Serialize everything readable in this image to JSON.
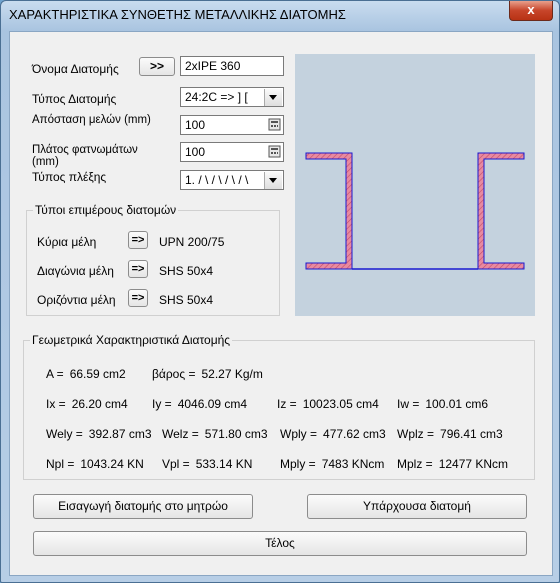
{
  "window": {
    "title": "ΧΑΡΑΚΤΗΡΙΣΤΙΚΑ ΣΥΝΘΕΤΗΣ ΜΕΤΑΛΛΙΚΗΣ ΔΙΑΤΟΜΗΣ",
    "close_glyph": "x"
  },
  "form": {
    "name_label": "Όνομα Διατομής",
    "browse_button": ">>",
    "name_value": "2xIPE 360",
    "type_label": "Τύπος Διατομής",
    "type_value": "24:2C => ] [",
    "distance_label": "Απόσταση μελών (mm)",
    "distance_value": "100",
    "width_label": "Πλάτος φατνωμάτων (mm)",
    "width_value": "100",
    "lacing_label": "Τύπος πλέξης",
    "lacing_value": "1. / \\ / \\ / \\ / \\"
  },
  "members": {
    "title": "Τύποι επιμέρους διατομών",
    "main_label": "Κύρια μέλη",
    "main_value": "UPN 200/75",
    "diagonal_label": "Διαγώνια μέλη",
    "diagonal_value": "SHS 50x4",
    "horizontal_label": "Οριζόντια μέλη",
    "horizontal_value": "SHS 50x4",
    "arrow_label": "=>"
  },
  "geometry": {
    "title": "Γεωμετρικά Χαρακτηριστικά Διατομής",
    "A_label": "A =",
    "A_value": "66.59 cm2",
    "weight_label": "βάρος =",
    "weight_value": "52.27 Kg/m",
    "Ix_label": "Ix =",
    "Ix_value": "26.20 cm4",
    "Iy_label": "Iy =",
    "Iy_value": "4046.09 cm4",
    "Iz_label": "Iz =",
    "Iz_value": "10023.05 cm4",
    "Iw_label": "Iw =",
    "Iw_value": "100.01 cm6",
    "Wely_label": "Wely =",
    "Wely_value": "392.87 cm3",
    "Welz_label": "Welz =",
    "Welz_value": "571.80 cm3",
    "Wply_label": "Wply =",
    "Wply_value": "477.62 cm3",
    "Wplz_label": "Wplz =",
    "Wplz_value": "796.41 cm3",
    "Npl_label": "Npl =",
    "Npl_value": "1043.24 KN",
    "Vpl_label": "Vpl =",
    "Vpl_value": "533.14 KN",
    "Mply_label": "Mply =",
    "Mply_value": "7483 KNcm",
    "Mplz_label": "Mplz =",
    "Mplz_value": "12477 KNcm"
  },
  "buttons": {
    "insert": "Εισαγωγή διατομής στο μητρώο",
    "existing": "Υπάρχουσα διατομή",
    "end": "Τέλος"
  },
  "colors": {
    "section_fill": "#e88aa0",
    "section_outline": "#1a1ad0",
    "preview_bg": "#c4d2de"
  }
}
